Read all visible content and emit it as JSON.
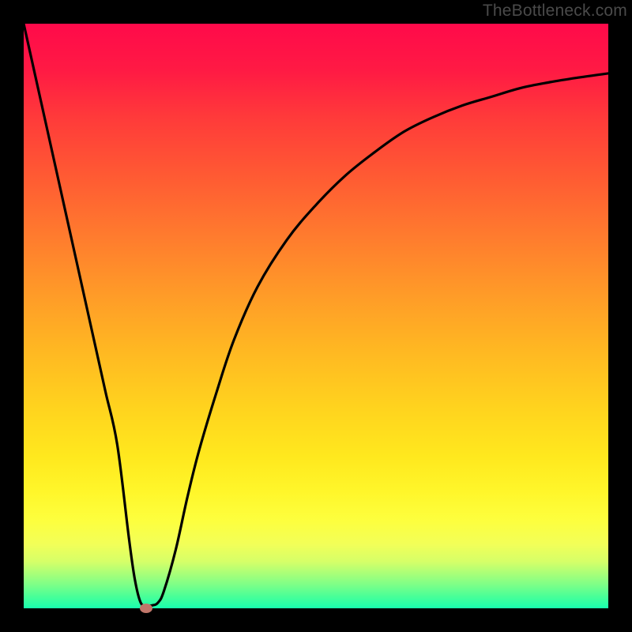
{
  "watermark": "TheBottleneck.com",
  "chart_data": {
    "type": "line",
    "title": "",
    "xlabel": "",
    "ylabel": "",
    "xlim": [
      0,
      100
    ],
    "ylim": [
      0,
      100
    ],
    "grid": false,
    "legend": false,
    "series": [
      {
        "name": "bottleneck-curve",
        "x": [
          0,
          2,
          4,
          6,
          8,
          10,
          12,
          14,
          16,
          18,
          19,
          20,
          21,
          22,
          23,
          24,
          26,
          28,
          30,
          33,
          36,
          40,
          45,
          50,
          55,
          60,
          65,
          70,
          75,
          80,
          85,
          90,
          95,
          100
        ],
        "y": [
          100,
          91,
          82,
          73,
          64,
          55,
          46,
          37,
          28,
          12,
          5,
          1,
          0.5,
          0.5,
          1,
          3,
          10,
          19,
          27,
          37,
          46,
          55,
          63,
          69,
          74,
          78,
          81.5,
          84,
          86,
          87.5,
          89,
          90,
          90.8,
          91.5
        ]
      }
    ],
    "marker": {
      "x": 21,
      "y": 0
    },
    "background_gradient": {
      "top": "#ff0a4a",
      "mid": "#ffd41e",
      "bottom": "#18ffae"
    },
    "line_color": "#000000",
    "marker_color": "#c1766a"
  }
}
